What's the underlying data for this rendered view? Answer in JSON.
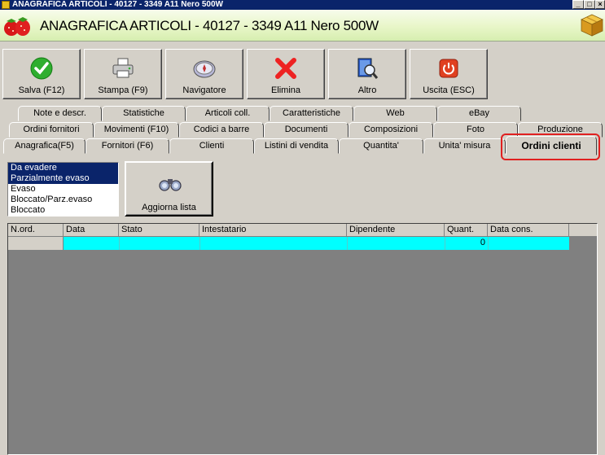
{
  "window": {
    "title": "ANAGRAFICA ARTICOLI - 40127 - 3349 A11 Nero 500W"
  },
  "header": {
    "title": "ANAGRAFICA ARTICOLI - 40127 - 3349 A11 Nero 500W"
  },
  "toolbar": {
    "salva": "Salva (F12)",
    "stampa": "Stampa (F9)",
    "navigatore": "Navigatore",
    "elimina": "Elimina",
    "altro": "Altro",
    "uscita": "Uscita (ESC)"
  },
  "tabs": {
    "row1": [
      "Note e descr.",
      "Statistiche",
      "Articoli coll.",
      "Caratteristiche",
      "Web",
      "eBay"
    ],
    "row2": [
      "Ordini fornitori",
      "Movimenti (F10)",
      "Codici a barre",
      "Documenti",
      "Composizioni",
      "Foto",
      "Produzione"
    ],
    "row3": [
      "Anagrafica(F5)",
      "Fornitori (F6)",
      "Clienti",
      "Listini di vendita",
      "Quantita'",
      "Unita' misura",
      "Ordini clienti"
    ]
  },
  "filter_list": {
    "items": [
      "Da evadere",
      "Parzialmente evaso",
      "Evaso",
      "Bloccato/Parz.evaso",
      "Bloccato"
    ],
    "selected": [
      "Da evadere",
      "Parzialmente evaso"
    ]
  },
  "refresh_button": "Aggiorna lista",
  "grid": {
    "columns": [
      "N.ord.",
      "Data",
      "Stato",
      "Intestatario",
      "Dipendente",
      "Quant.",
      "Data cons."
    ],
    "total_quantity": "0"
  },
  "colors": {
    "grid_total_row": "#00ffff",
    "selection": "#0a246a",
    "highlight": "#e02020"
  }
}
